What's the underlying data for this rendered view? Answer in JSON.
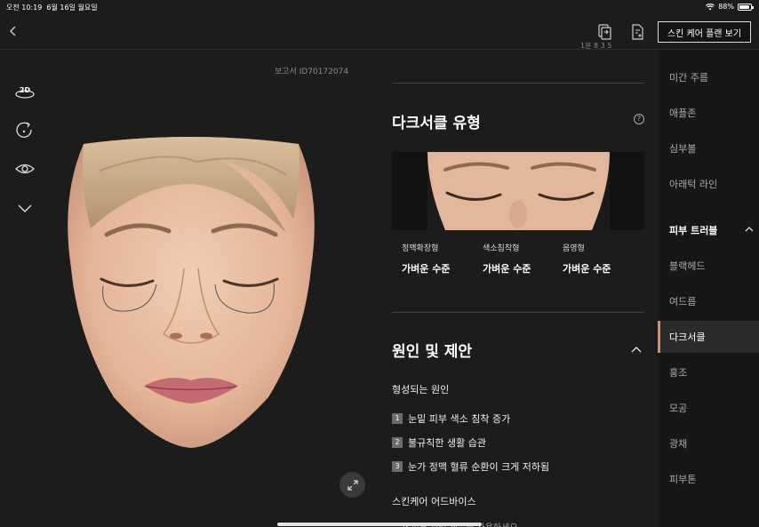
{
  "status_bar": {
    "time": "오전 10:19",
    "date": "6월 16일 월요일",
    "battery": "88%"
  },
  "header": {
    "plan_button": "스킨 케어 플랜 보기"
  },
  "report": {
    "id_label": "보고서 ID70172074"
  },
  "tools": {
    "view_2d": "2D"
  },
  "dark_circle": {
    "top_cut": "1분 8 3 5",
    "title": "다크서클 유형",
    "types": [
      {
        "label": "정맥확장형",
        "level": "가벼운 수준"
      },
      {
        "label": "색소침착형",
        "level": "가벼운 수준"
      },
      {
        "label": "음영형",
        "level": "가벼운 수준"
      }
    ]
  },
  "causes": {
    "title": "원인 및 제안",
    "subtitle": "형성되는 원인",
    "items": [
      {
        "num": "1",
        "text": "눈밑 피부 색소 침착 증가"
      },
      {
        "num": "2",
        "text": "불규칙한 생활 습관"
      },
      {
        "num": "3",
        "text": "눈가 정맥 혈류 순환이 크게 저하됨"
      }
    ],
    "advice_title": "스킨케어 어드바이스",
    "advice_cut": "눈가 피부 관리 제품을 사용하세요"
  },
  "sidebar": {
    "items_top": [
      "미간 주름",
      "애플존",
      "심부볼",
      "아래턱 라인"
    ],
    "group": "피부 트러블",
    "items_group": [
      "블랙헤드",
      "여드름",
      "다크서클",
      "홍조",
      "모공",
      "광채",
      "피부톤"
    ],
    "active": "다크서클"
  },
  "colors": {
    "accent": "#c9907a",
    "background": "#1c1c1c",
    "sidebar": "#171717"
  }
}
